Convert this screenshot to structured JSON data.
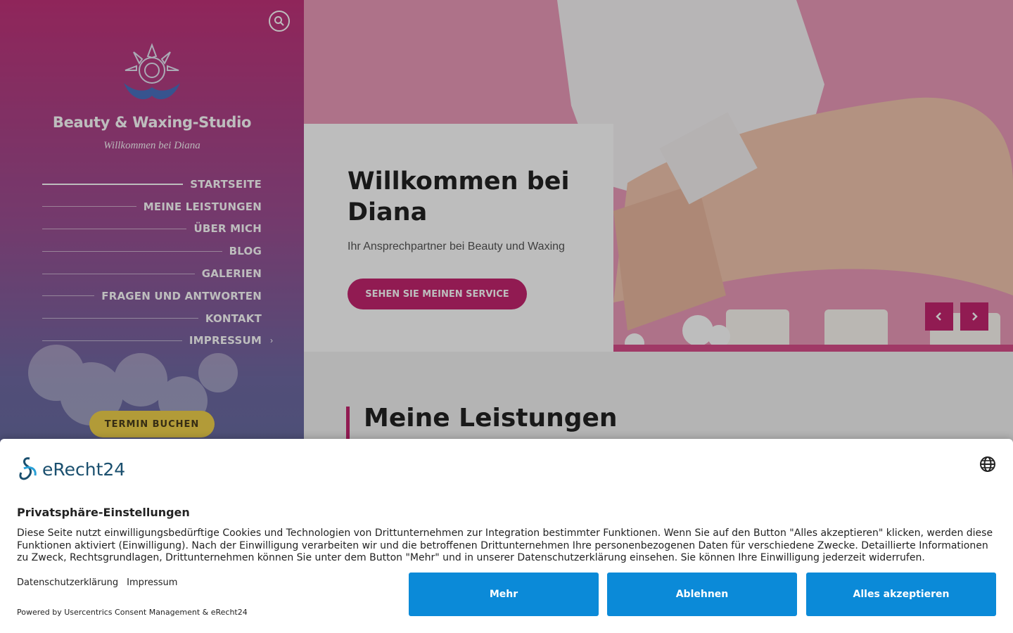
{
  "sidebar": {
    "title": "Beauty & Waxing-Studio",
    "tagline": "Willkommen bei Diana",
    "nav": [
      {
        "label": "STARTSEITE"
      },
      {
        "label": "MEINE LEISTUNGEN"
      },
      {
        "label": "ÜBER MICH"
      },
      {
        "label": "BLOG"
      },
      {
        "label": "GALERIEN"
      },
      {
        "label": "FRAGEN UND ANTWORTEN"
      },
      {
        "label": "KONTAKT"
      },
      {
        "label": "IMPRESSUM"
      }
    ],
    "book_button": "TERMIN BUCHEN"
  },
  "hero": {
    "title": "Willkommen bei Diana",
    "subtitle": "Ihr Ansprechpartner bei Beauty und Waxing",
    "cta": "SEHEN SIE MEINEN SERVICE"
  },
  "section": {
    "title": "Meine Leistungen"
  },
  "consent": {
    "brand": "eRecht24",
    "title": "Privatsphäre-Einstellungen",
    "text": "Diese Seite nutzt einwilligungsbedürftige Cookies und Technologien von Drittunternehmen zur Integration bestimmter Funktionen. Wenn Sie auf den Button \"Alles akzeptieren\" klicken, werden diese Funktionen aktiviert (Einwilligung). Nach der Einwilligung verarbeiten wir und die betroffenen Drittunternehmen Ihre personenbezogenen Daten für verschiedene Zwecke. Detaillierte Informationen zu Zweck, Rechtsgrundlagen, Drittunternehmen können Sie unter dem Button \"Mehr\" und in unserer Datenschutzerklärung einsehen. Sie können Ihre Einwilligung jederzeit widerrufen.",
    "link_privacy": "Datenschutzerklärung",
    "link_imprint": "Impressum",
    "powered": "Powered by Usercentrics Consent Management & eRecht24",
    "btn_more": "Mehr",
    "btn_decline": "Ablehnen",
    "btn_accept": "Alles akzeptieren"
  },
  "colors": {
    "accent": "#c4256f",
    "book_button": "#f0d24c",
    "consent_button": "#0b8ad8"
  }
}
